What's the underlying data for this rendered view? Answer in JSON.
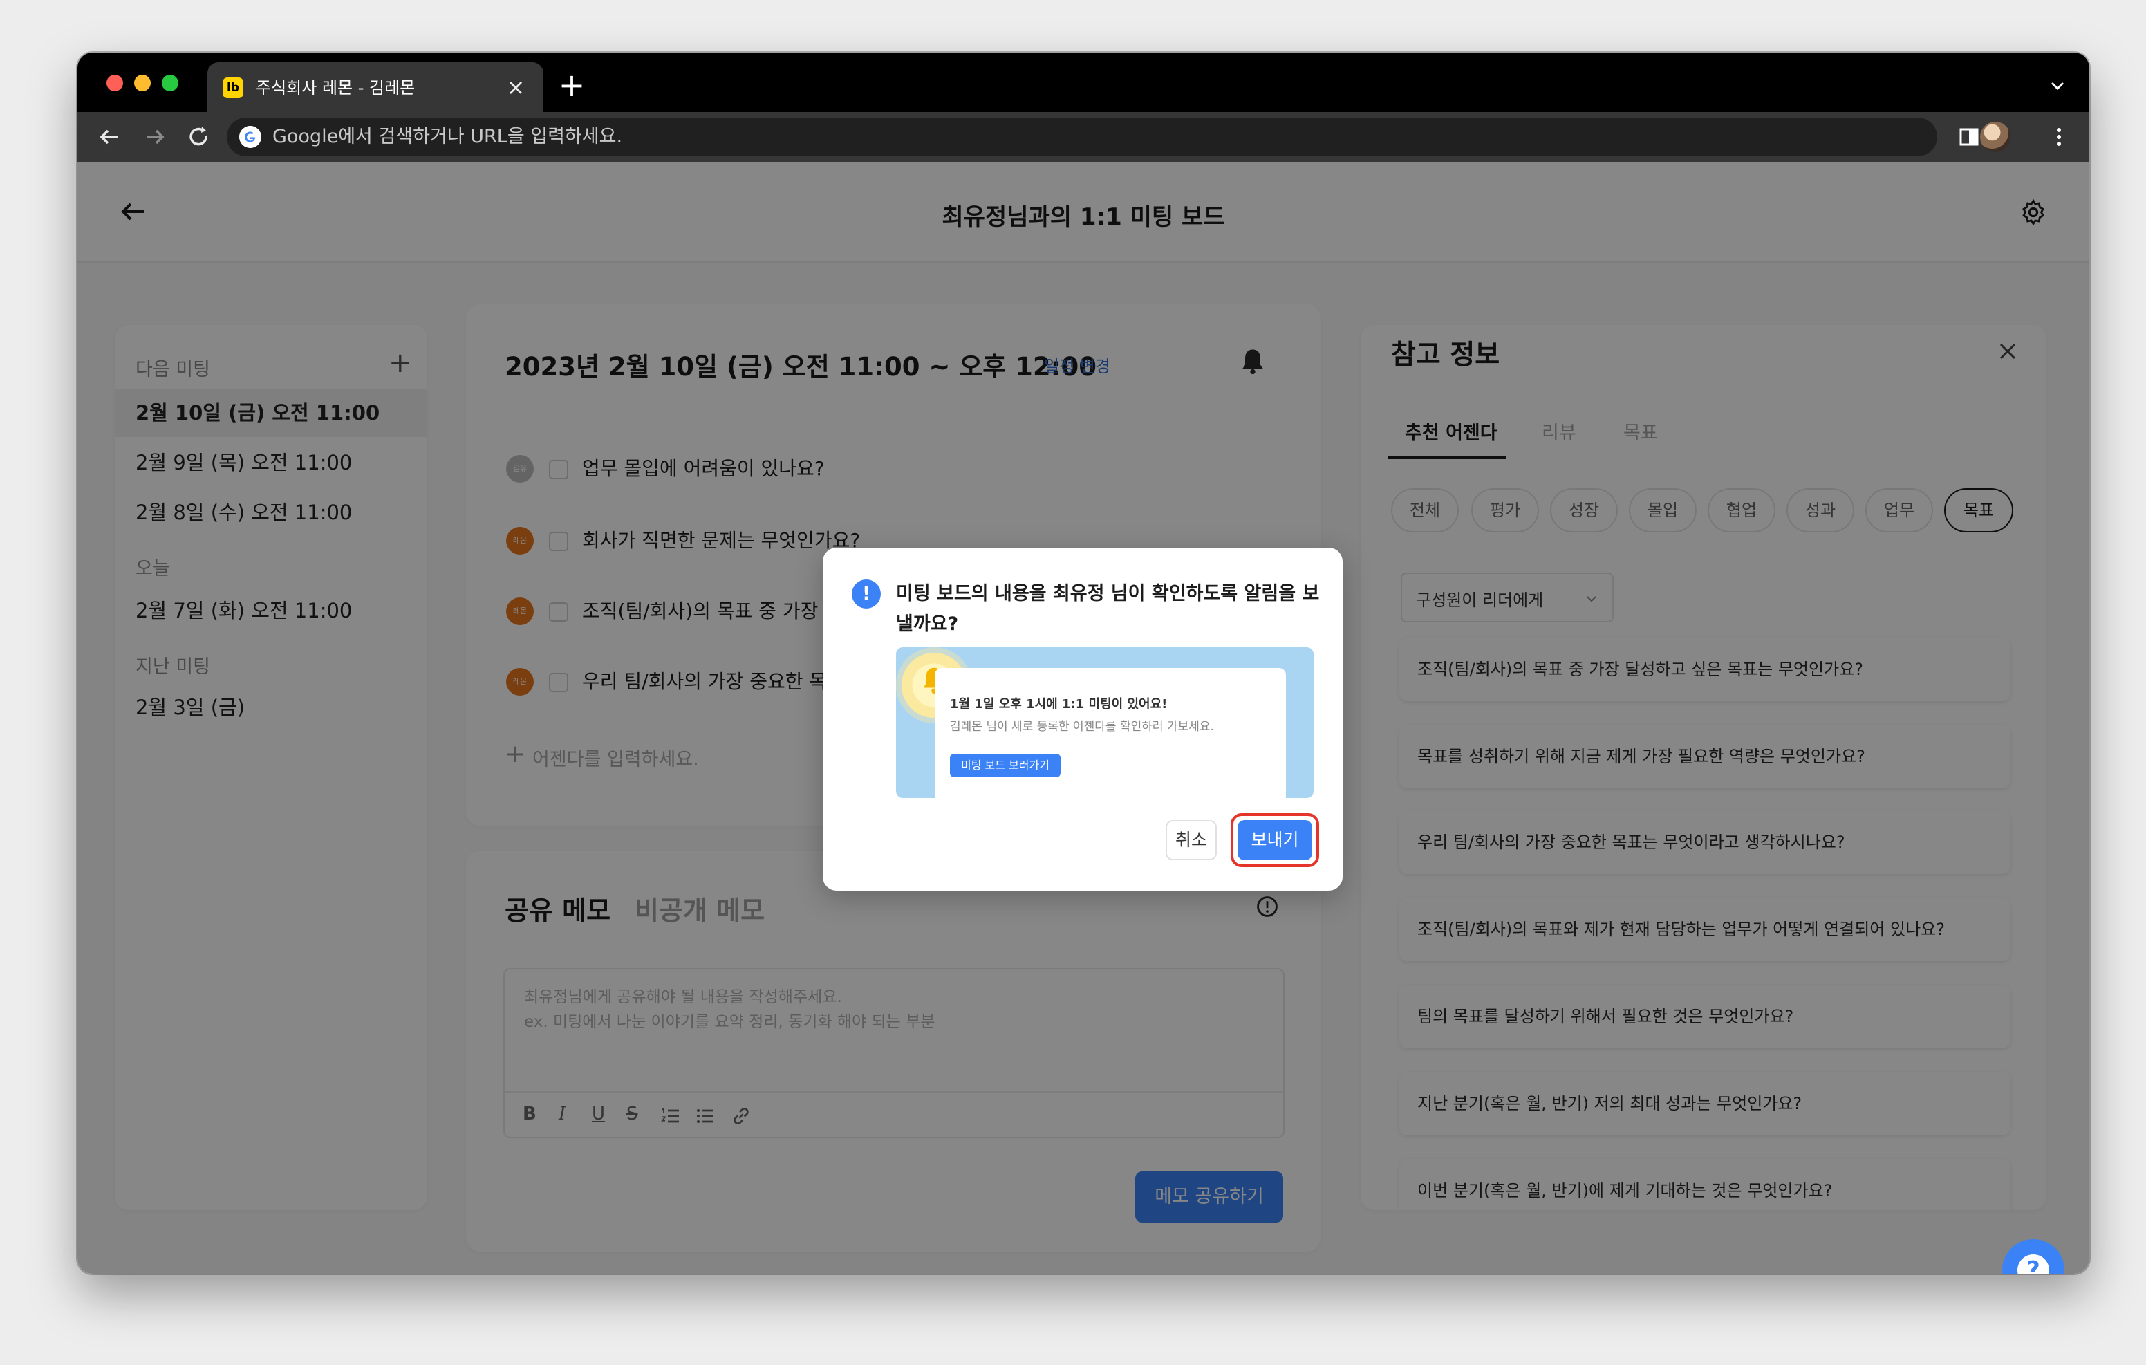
{
  "browser": {
    "tab_title": "주식회사 레몬 - 김레몬",
    "tab_favicon_text": "lb",
    "new_tab": "+",
    "address_placeholder": "Google에서 검색하거나 URL을 입력하세요."
  },
  "header": {
    "title": "최유정님과의 1:1 미팅 보드"
  },
  "sidebar": {
    "next_label": "다음 미팅",
    "add": "+",
    "next_items": [
      "2월 10일 (금) 오전 11:00",
      "2월 9일 (목) 오전 11:00",
      "2월 8일 (수) 오전 11:00"
    ],
    "today_label": "오늘",
    "today_items": [
      "2월 7일 (화) 오전 11:00"
    ],
    "past_label": "지난 미팅",
    "past_items": [
      "2월 3일 (금)"
    ]
  },
  "meeting": {
    "datetime": "2023년 2월 10일 (금) 오전 11:00 ~ 오후 12:00",
    "change_link": "일정 변경",
    "agenda": [
      {
        "avatar": "김유",
        "text": "업무 몰입에 어려움이 있나요?"
      },
      {
        "avatar": "레몬",
        "text": "회사가 직면한 문제는 무엇인가요?"
      },
      {
        "avatar": "레몬",
        "text": "조직(팀/회사)의 목표 중 가장 달성하고 싶은 목표는 무엇인가요?"
      },
      {
        "avatar": "레몬",
        "text": "우리 팀/회사의 가장 중요한 목표는 무엇이라고 생각하시나요?"
      }
    ],
    "add_placeholder": "어젠다를 입력하세요."
  },
  "memo": {
    "tab_shared": "공유 메모",
    "tab_private": "비공개 메모",
    "placeholder_line1": "최유정님에게 공유해야 될 내용을 작성해주세요.",
    "placeholder_line2": "ex. 미팅에서 나눈 이야기를 요약 정리, 동기화 해야 되는 부분",
    "toolbar": [
      "B",
      "I",
      "U",
      "S"
    ],
    "share_button": "메모 공유하기"
  },
  "reference": {
    "title": "참고 정보",
    "tabs": [
      "추천 어젠다",
      "리뷰",
      "목표"
    ],
    "chips": [
      "전체",
      "평가",
      "성장",
      "몰입",
      "협업",
      "성과",
      "업무",
      "목표"
    ],
    "dropdown": "구성원이 리더에게",
    "questions": [
      "조직(팀/회사)의 목표 중 가장 달성하고 싶은 목표는 무엇인가요?",
      "목표를 성취하기 위해 지금 제게 가장 필요한 역량은 무엇인가요?",
      "우리 팀/회사의 가장 중요한 목표는 무엇이라고 생각하시나요?",
      "조직(팀/회사)의 목표와 제가 현재 담당하는 업무가 어떻게 연결되어 있나요?",
      "팀의 목표를 달성하기 위해서 필요한 것은 무엇인가요?",
      "지난 분기(혹은 월, 반기) 저의 최대 성과는 무엇인가요?",
      "이번 분기(혹은 월, 반기)에 제게 기대하는 것은 무엇인가요?"
    ]
  },
  "modal": {
    "message_line1": "미팅 보드의 내용을 최유정 님이 확인하도록 알림을 보",
    "message_line2": "낼까요?",
    "preview_title": "1월 1일 오후 1시에 1:1 미팅이 있어요!",
    "preview_body": "김레몬 님이 새로 등록한 어젠다를 확인하러 가보세요.",
    "preview_button": "미팅 보드 보러가기",
    "cancel": "취소",
    "send": "보내기"
  },
  "help": "?",
  "colors": {
    "accent": "#3b82f6",
    "highlight": "#e5352b",
    "brand_yellow": "#ffd400"
  }
}
